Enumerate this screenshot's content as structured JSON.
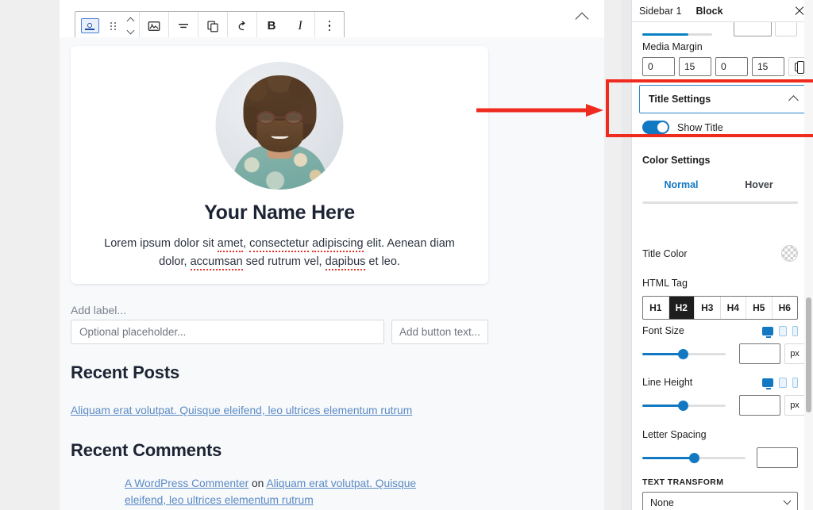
{
  "editor": {
    "toolbar": {
      "block_type_icon": "author-block-icon",
      "drag_handle_icon": "drag-handle-icon",
      "move_up_icon": "chevron-up-icon",
      "move_down_icon": "chevron-down-icon",
      "image_icon": "image-icon",
      "align_icon": "align-center-icon",
      "duplicate_icon": "copy-icon",
      "link_icon": "link-icon",
      "bold_label": "B",
      "italic_label": "I",
      "more_icon": "more-vertical-icon",
      "collapse_icon": "chevron-up-icon"
    },
    "card": {
      "avatar_alt": "avatar",
      "title": "Your Name Here",
      "description_part1": "Lorem ipsum dolor sit ",
      "description_sp1": "amet",
      "description_part2": ", ",
      "description_sp2": "consectetur",
      "description_part3": " ",
      "description_sp3": "adipiscing",
      "description_part4": " elit. Aenean diam dolor, ",
      "description_sp4": "accumsan",
      "description_part5": " sed rutrum vel, ",
      "description_sp5": "dapibus",
      "description_part6": " et leo."
    },
    "form": {
      "label_placeholder": "Add label...",
      "input_placeholder": "Optional placeholder...",
      "button_placeholder": "Add button text..."
    },
    "recent_posts": {
      "heading": "Recent Posts",
      "items": [
        "Aliquam erat volutpat. Quisque eleifend, leo ultrices elementum rutrum"
      ]
    },
    "recent_comments": {
      "heading": "Recent Comments",
      "items": [
        {
          "author": "A WordPress Commenter",
          "connector": " on ",
          "post": "Aliquam erat volutpat. Quisque eleifend, leo ultrices elementum rutrum"
        }
      ]
    }
  },
  "sidebar": {
    "tabs": [
      {
        "label": "Sidebar 1",
        "active": false
      },
      {
        "label": "Block",
        "active": true
      }
    ],
    "close_icon": "close-icon",
    "media_margin": {
      "label": "Media Margin",
      "values": [
        "0",
        "15",
        "0",
        "15"
      ],
      "link_icon": "link-sides-icon"
    },
    "title_settings": {
      "label": "Title Settings",
      "expanded": true,
      "chevron_icon": "chevron-up-icon",
      "highlight_color": "#ef2b1f",
      "border_color": "#2b87c9"
    },
    "show_title": {
      "label": "Show Title",
      "enabled": true,
      "accent": "#1378c2"
    },
    "color_settings": {
      "heading": "Color Settings",
      "tabs": [
        {
          "label": "Normal",
          "active": true
        },
        {
          "label": "Hover",
          "active": false
        }
      ],
      "title_color_label": "Title Color",
      "title_color_value": "transparent"
    },
    "html_tag": {
      "label": "HTML Tag",
      "options": [
        "H1",
        "H2",
        "H3",
        "H4",
        "H5",
        "H6"
      ],
      "selected": "H2"
    },
    "font_size": {
      "label": "Font Size",
      "value": "",
      "unit": "px",
      "slider_percent": 42,
      "devices": [
        {
          "name": "desktop-icon",
          "active": true
        },
        {
          "name": "tablet-icon",
          "active": false
        },
        {
          "name": "mobile-icon",
          "active": false
        }
      ]
    },
    "line_height": {
      "label": "Line Height",
      "value": "",
      "unit": "px",
      "slider_percent": 42,
      "devices": [
        {
          "name": "desktop-icon",
          "active": true
        },
        {
          "name": "tablet-icon",
          "active": false
        },
        {
          "name": "mobile-icon",
          "active": false
        }
      ]
    },
    "letter_spacing": {
      "label": "Letter Spacing",
      "value": "",
      "slider_percent": 50
    },
    "text_transform": {
      "label": "TEXT TRANSFORM",
      "selected": "None",
      "chevron_icon": "chevron-down-icon"
    }
  },
  "annotations": {
    "arrow_color": "#ef2b1f",
    "box_color": "#ef2b1f"
  }
}
